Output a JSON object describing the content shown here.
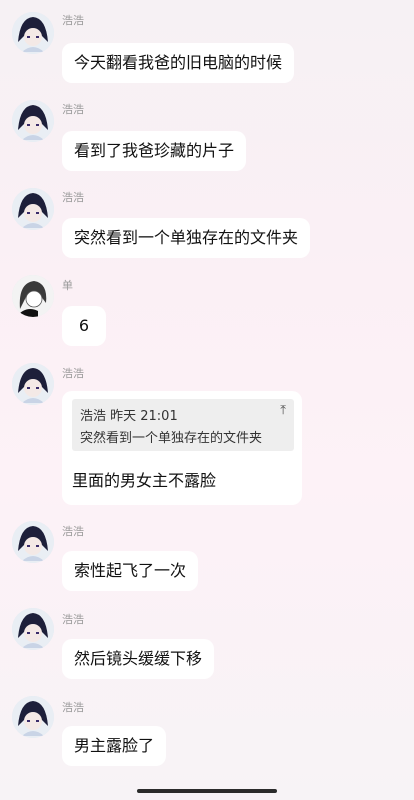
{
  "messages": [
    {
      "sender": "浩浩",
      "text": "今天翻看我爸的旧电脑的时候"
    },
    {
      "sender": "浩浩",
      "text": "看到了我爸珍藏的片子"
    },
    {
      "sender": "浩浩",
      "text": "突然看到一个单独存在的文件夹"
    },
    {
      "sender": "单",
      "text": "6"
    },
    {
      "sender": "浩浩",
      "quote": {
        "header": "浩浩 昨天 21:01",
        "text": "突然看到一个单独存在的文件夹",
        "pin_icon": "arrow-up-to-top-icon"
      },
      "text": "里面的男女主不露脸"
    },
    {
      "sender": "浩浩",
      "text": "索性起飞了一次"
    },
    {
      "sender": "浩浩",
      "text": "然后镜头缓缓下移"
    },
    {
      "sender": "浩浩",
      "text": "男主露脸了"
    }
  ],
  "colors": {
    "bubble": "#ffffff",
    "background": "#fbf0f5",
    "quote_bg": "#eeeeee",
    "name": "#9a9a9a"
  }
}
